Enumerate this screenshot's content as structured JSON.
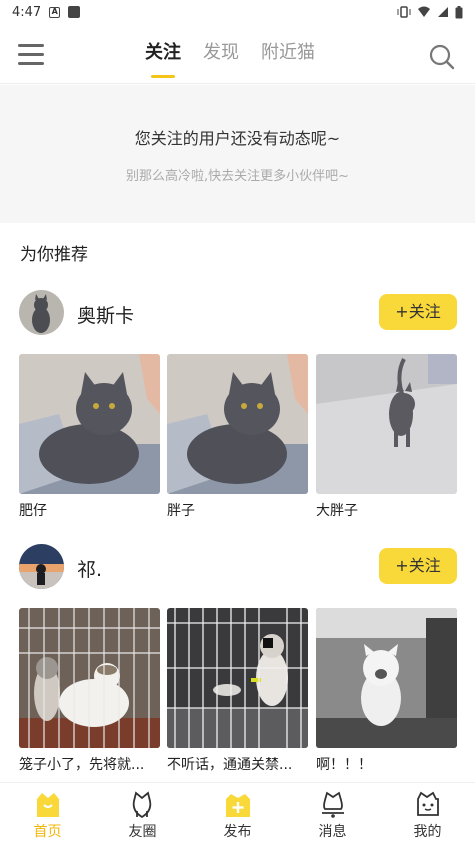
{
  "status_bar": {
    "time": "4:47"
  },
  "top_nav": {
    "tabs": [
      {
        "label": "关注"
      },
      {
        "label": "发现"
      },
      {
        "label": "附近猫"
      }
    ]
  },
  "notice": {
    "title": "您关注的用户还没有动态呢~",
    "subtitle": "别那么高冷啦,快去关注更多小伙伴吧~"
  },
  "recommend": {
    "title": "为你推荐",
    "users": [
      {
        "name": "奥斯卡",
        "follow_label": "+关注",
        "photos": [
          {
            "caption": "肥仔"
          },
          {
            "caption": "胖子"
          },
          {
            "caption": "大胖子"
          }
        ]
      },
      {
        "name": "祁.",
        "follow_label": "+关注",
        "photos": [
          {
            "caption": "笼子小了，先将就..."
          },
          {
            "caption": "不听话，通通关禁..."
          },
          {
            "caption": "啊！！！"
          }
        ]
      }
    ]
  },
  "bottom_nav": {
    "items": [
      {
        "label": "首页",
        "icon": "home-cat-icon"
      },
      {
        "label": "友圈",
        "icon": "friends-cat-icon"
      },
      {
        "label": "发布",
        "icon": "publish-plus-icon"
      },
      {
        "label": "消息",
        "icon": "message-cat-icon"
      },
      {
        "label": "我的",
        "icon": "profile-cat-icon"
      }
    ]
  },
  "colors": {
    "accent": "#f9d93a",
    "accent_text": "#f2b705"
  }
}
